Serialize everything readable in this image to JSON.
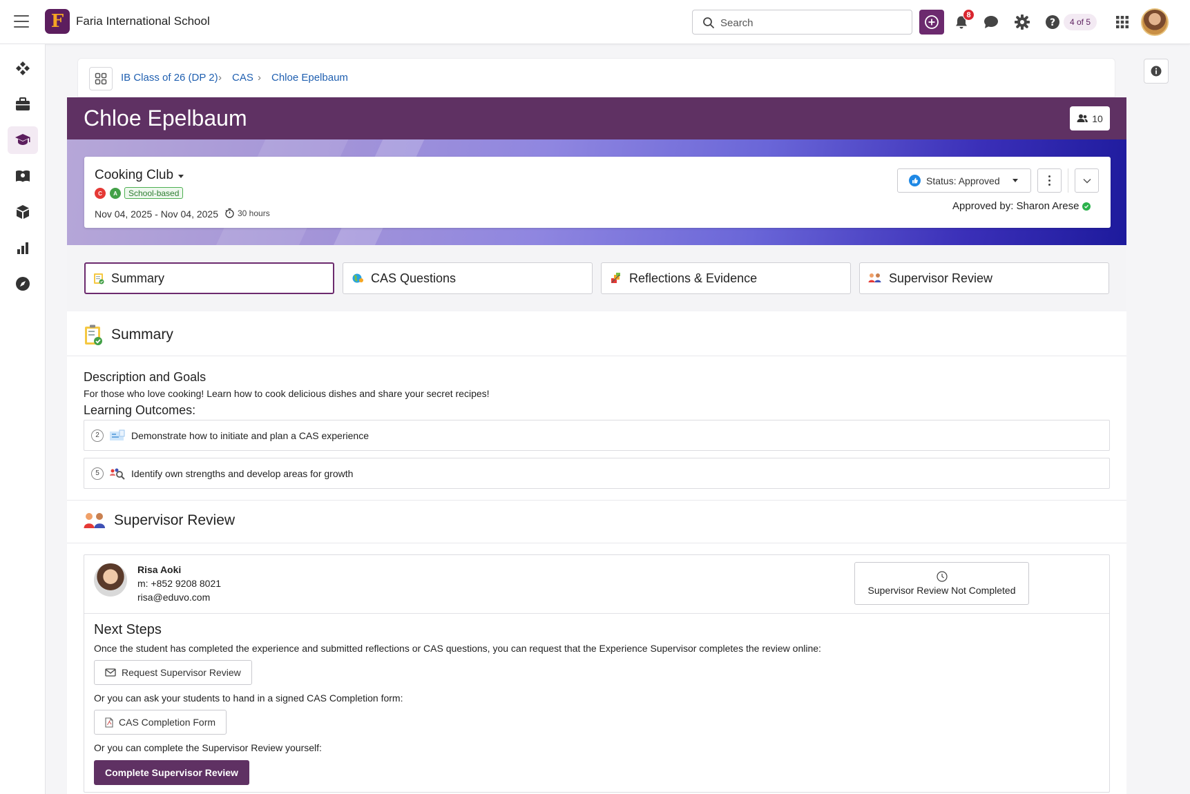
{
  "header": {
    "school_name": "Faria International School",
    "logo_letter": "F",
    "search_placeholder": "Search",
    "notification_count": "8",
    "page_count": "4 of 5"
  },
  "breadcrumb": [
    "IB Class of 26 (DP 2)",
    "CAS",
    "Chloe Epelbaum"
  ],
  "hero": {
    "student_name": "Chloe Epelbaum",
    "member_count": "10"
  },
  "experience": {
    "title": "Cooking Club",
    "strands": [
      {
        "letter": "C",
        "color": "#e53935"
      },
      {
        "letter": "A",
        "color": "#43a047"
      }
    ],
    "tag": "School-based",
    "dates": "Nov 04, 2025 - Nov 04, 2025",
    "hours": "30 hours",
    "status": "Status: Approved",
    "approved_by": "Approved by: Sharon Arese"
  },
  "tabs": [
    "Summary",
    "CAS Questions",
    "Reflections & Evidence",
    "Supervisor Review"
  ],
  "summary": {
    "heading": "Summary",
    "desc_heading": "Description and Goals",
    "description": "For those who love cooking! Learn how to cook delicious dishes and share your secret recipes!",
    "outcomes_heading": "Learning Outcomes:",
    "outcomes": [
      {
        "number": "2",
        "text": "Demonstrate how to initiate and plan a CAS experience"
      },
      {
        "number": "5",
        "text": "Identify own strengths and develop areas for growth"
      }
    ]
  },
  "supervisor": {
    "heading": "Supervisor Review",
    "name": "Risa Aoki",
    "phone": "m: +852 9208 8021",
    "email": "risa@eduvo.com",
    "status": "Supervisor Review Not Completed",
    "next_steps_title": "Next Steps",
    "step1_text": "Once the student has completed the experience and submitted reflections or CAS questions, you can request that the Experience Supervisor completes the review online:",
    "request_btn": "Request Supervisor Review",
    "step2_text": "Or you can ask your students to hand in a signed CAS Completion form:",
    "form_btn": "CAS Completion Form",
    "step3_text": "Or you can complete the Supervisor Review yourself:",
    "complete_btn": "Complete Supervisor Review"
  },
  "colors": {
    "brand": "#5f3163",
    "link": "#1f5fb0",
    "badge": "#d9262f",
    "approved": "#2bb24c"
  }
}
